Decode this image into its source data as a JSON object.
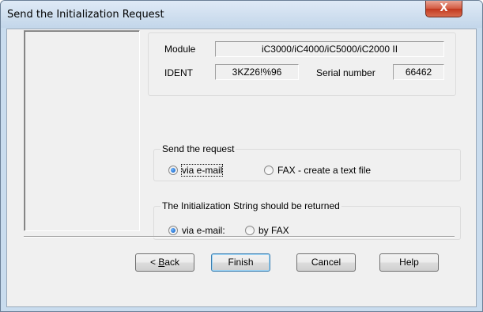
{
  "window": {
    "title": "Send the Initialization Request",
    "close_glyph": "X"
  },
  "module": {
    "module_label": "Module",
    "module_value": "iC3000/iC4000/iC5000/iC2000 II",
    "ident_label": "IDENT",
    "ident_value": "3KZ26!%96",
    "serial_label": "Serial number",
    "serial_value": "66462"
  },
  "send_request": {
    "legend": "Send the request",
    "options": [
      {
        "label": "via e-mail",
        "checked": true
      },
      {
        "label": "FAX - create a text file",
        "checked": false
      }
    ]
  },
  "return_method": {
    "legend": "The Initialization String should be returned",
    "options": [
      {
        "label": "via e-mail:",
        "checked": true
      },
      {
        "label": "by FAX",
        "checked": false
      }
    ]
  },
  "buttons": {
    "back_prefix": "< ",
    "back_mnemonic": "B",
    "back_rest": "ack",
    "finish": "Finish",
    "cancel": "Cancel",
    "help": "Help"
  }
}
